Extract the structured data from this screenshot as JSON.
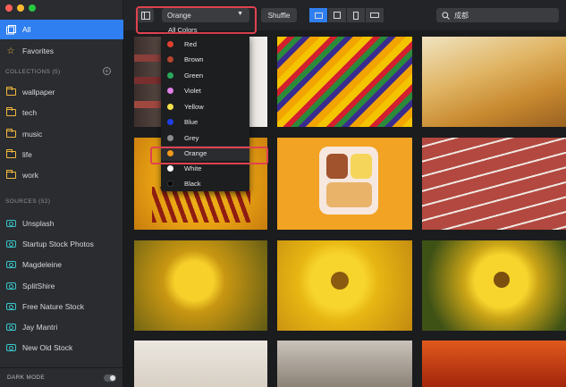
{
  "sidebar": {
    "items": [
      {
        "label": "All"
      },
      {
        "label": "Favorites"
      }
    ],
    "collections_header": "COLLECTIONS (5)",
    "collections": [
      {
        "label": "wallpaper"
      },
      {
        "label": "tech"
      },
      {
        "label": "music"
      },
      {
        "label": "life"
      },
      {
        "label": "work"
      }
    ],
    "sources_header": "SOURCES (52)",
    "sources": [
      {
        "label": "Unsplash"
      },
      {
        "label": "Startup Stock Photos"
      },
      {
        "label": "Magdeleine"
      },
      {
        "label": "SplitShire"
      },
      {
        "label": "Free Nature Stock"
      },
      {
        "label": "Jay Mantri"
      },
      {
        "label": "New Old Stock"
      }
    ],
    "dark_mode_label": "DARK MODE"
  },
  "toolbar": {
    "color_filter_value": "Orange",
    "shuffle_label": "Shuffle",
    "search_value": "成都"
  },
  "color_dropdown": {
    "header": "All Colors",
    "options": [
      {
        "label": "Red",
        "color": "#e0412f"
      },
      {
        "label": "Brown",
        "color": "#b5442e"
      },
      {
        "label": "Green",
        "color": "#2aa85a"
      },
      {
        "label": "Violet",
        "color": "#e07fe6"
      },
      {
        "label": "Yellow",
        "color": "#f5e14a"
      },
      {
        "label": "Blue",
        "color": "#1f3fe6"
      },
      {
        "label": "Grey",
        "color": "#8a8c8f"
      },
      {
        "label": "Orange",
        "color": "#f19a1a"
      },
      {
        "label": "White",
        "color": "#ffffff"
      },
      {
        "label": "Black",
        "color": "#050505"
      }
    ],
    "selected": "Orange"
  },
  "colors": {
    "accent": "#2f7ff0",
    "highlight_box": "#e0424f",
    "folder": "#f2b83b",
    "source_icon": "#39c6c9"
  },
  "icons": {
    "all": "photos-icon",
    "favorites": "star-icon",
    "collection": "folder-icon",
    "source": "camera-icon",
    "search": "search-icon",
    "sidebar_toggle": "sidebar-toggle-icon",
    "dropdown": "caret-down-icon"
  }
}
